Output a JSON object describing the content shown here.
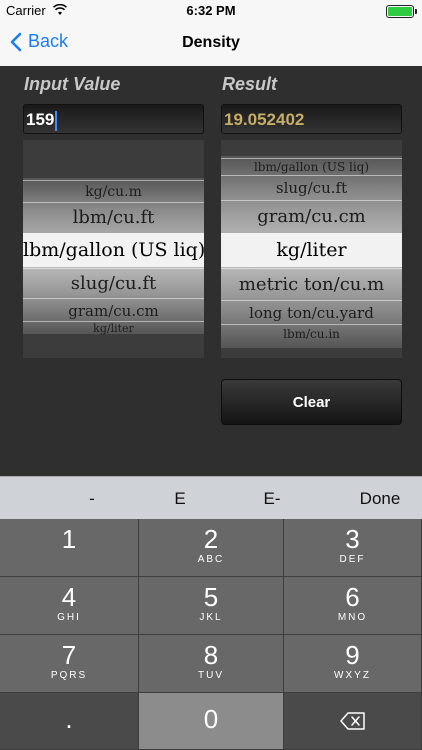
{
  "status": {
    "carrier": "Carrier",
    "time": "6:32 PM"
  },
  "nav": {
    "back_label": "Back",
    "title": "Density"
  },
  "input": {
    "label": "Input Value",
    "value": "159"
  },
  "result": {
    "label": "Result",
    "value": "19.052402"
  },
  "left_picker": {
    "items": [
      "kg/cu.m",
      "lbm/cu.ft",
      "lbm/gallon (US liq)",
      "slug/cu.ft",
      "gram/cu.cm",
      "kg/liter"
    ],
    "selected": "lbm/gallon (US liq)"
  },
  "right_picker": {
    "items": [
      "lbm/gallon (US liq)",
      "slug/cu.ft",
      "gram/cu.cm",
      "kg/liter",
      "metric ton/cu.m",
      "long ton/cu.yard",
      "lbm/cu.in"
    ],
    "selected": "kg/liter"
  },
  "clear_label": "Clear",
  "accessory": {
    "minus": "-",
    "e": "E",
    "e_minus": "E-",
    "done": "Done"
  },
  "keypad": {
    "k1": {
      "num": "1",
      "letters": ""
    },
    "k2": {
      "num": "2",
      "letters": "ABC"
    },
    "k3": {
      "num": "3",
      "letters": "DEF"
    },
    "k4": {
      "num": "4",
      "letters": "GHI"
    },
    "k5": {
      "num": "5",
      "letters": "JKL"
    },
    "k6": {
      "num": "6",
      "letters": "MNO"
    },
    "k7": {
      "num": "7",
      "letters": "PQRS"
    },
    "k8": {
      "num": "8",
      "letters": "TUV"
    },
    "k9": {
      "num": "9",
      "letters": "WXYZ"
    },
    "dot": ".",
    "k0": "0"
  }
}
